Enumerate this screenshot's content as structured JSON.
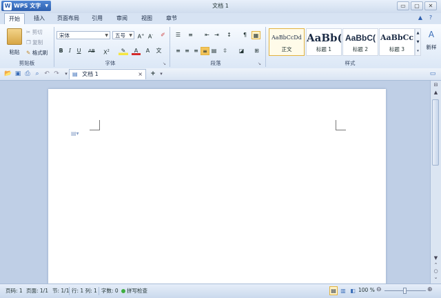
{
  "app": {
    "menu_label": "WPS 文字",
    "title": "文档 1"
  },
  "tabs": [
    "开始",
    "插入",
    "页面布局",
    "引用",
    "审阅",
    "视图",
    "章节"
  ],
  "active_tab": "开始",
  "clipboard": {
    "paste": "粘贴",
    "cut": "剪切",
    "copy": "复制",
    "format_painter": "格式刷",
    "group": "剪贴板"
  },
  "font": {
    "family": "宋体",
    "size": "五号",
    "group": "字体"
  },
  "paragraph": {
    "group": "段落"
  },
  "styles": {
    "items": [
      {
        "sample": "AaBbCcDd",
        "name": "正文"
      },
      {
        "sample": "AaBb(",
        "name": "标题 1"
      },
      {
        "sample": "AaBbC(",
        "name": "标题 2"
      },
      {
        "sample": "AaBbCc",
        "name": "标题 3"
      }
    ],
    "new_style": "新样",
    "group": "样式"
  },
  "document_tab": {
    "label": "文档 1"
  },
  "status": {
    "page": "页码: 1",
    "pages": "页面: 1/1",
    "section": "节: 1/1",
    "row_col": "行: 1  列: 1",
    "words": "字数: 0",
    "spell": "拼写检查",
    "zoom": "100 %"
  },
  "colors": {
    "accent": "#2e5fae",
    "highlight": "#e2b23e",
    "font_color": "#d42a2a"
  }
}
